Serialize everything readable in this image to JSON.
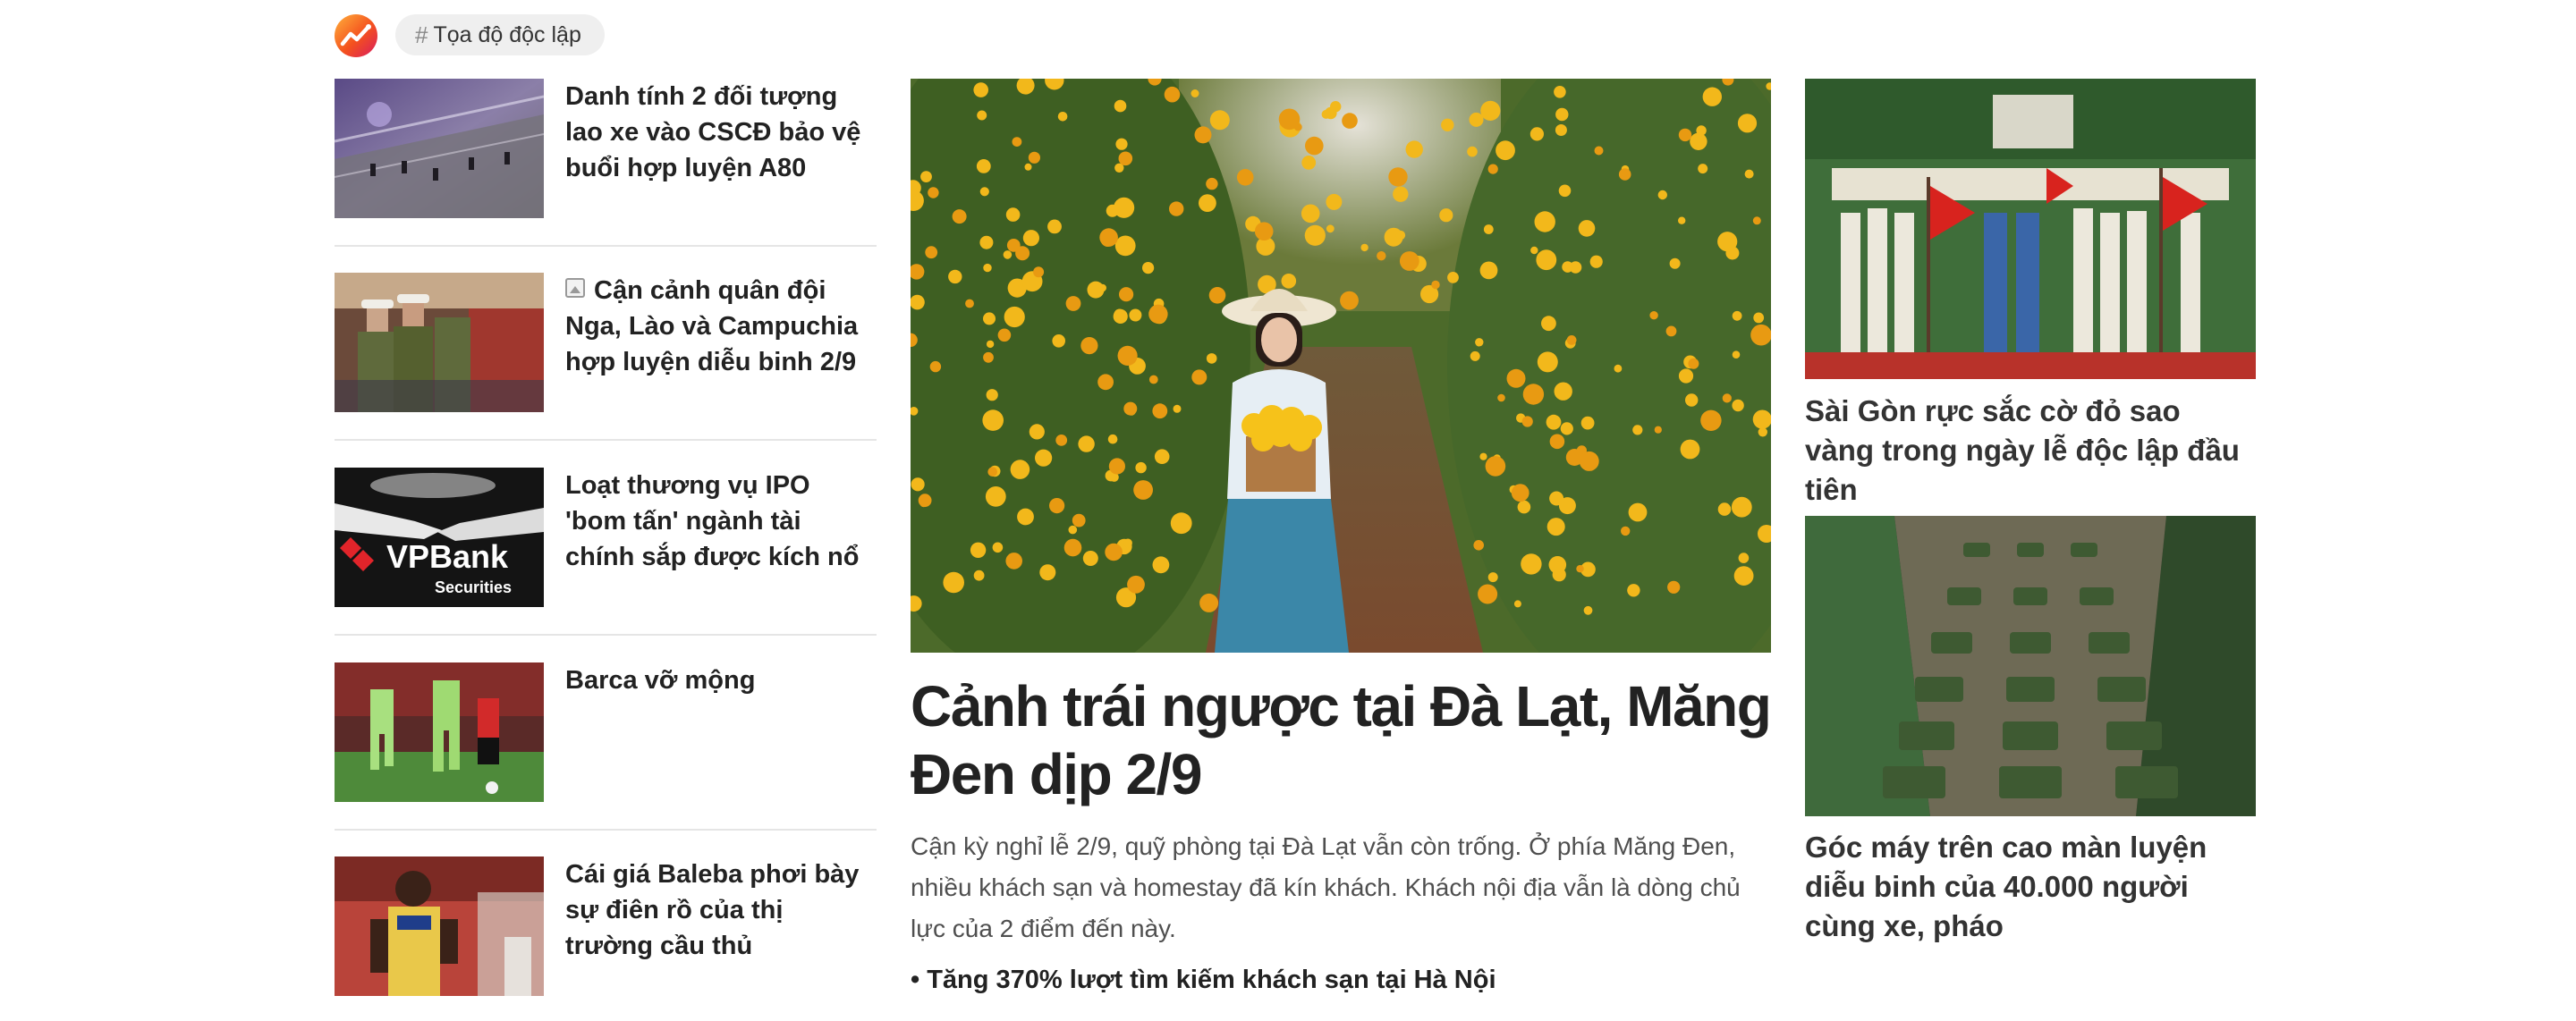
{
  "header": {
    "logo_icon": "trending-logo-icon",
    "tag_icon": "hash",
    "tag_label": "Tọa độ độc lập"
  },
  "left_list": [
    {
      "title": "Danh tính 2 đối tượng lao xe vào CSCĐ bảo vệ buổi hợp luyện A80",
      "has_gallery_icon": false
    },
    {
      "title": "Cận cảnh quân đội Nga, Lào và Campuchia hợp luyện diễu binh 2/9",
      "has_gallery_icon": true
    },
    {
      "title": "Loạt thương vụ IPO 'bom tấn' ngành tài chính sắp được kích nổ",
      "has_gallery_icon": false,
      "image_text": [
        "VPBank",
        "Securities"
      ]
    },
    {
      "title": "Barca vỡ mộng",
      "has_gallery_icon": false
    },
    {
      "title": "Cái giá Baleba phơi bày sự điên rồ của thị trường cầu thủ",
      "has_gallery_icon": false
    }
  ],
  "main": {
    "title": "Cảnh trái ngược tại Đà Lạt, Măng Đen dịp 2/9",
    "lead": "Cận kỳ nghỉ lễ 2/9, quỹ phòng tại Đà Lạt vẫn còn trống. Ở phía Măng Đen, nhiều khách sạn và homestay đã kín khách. Khách nội địa vẫn là dòng chủ lực của 2 điểm đến này.",
    "related_bullet": "•",
    "related": "Tăng 370% lượt tìm kiếm khách sạn tại Hà Nội"
  },
  "right": [
    {
      "title": "Sài Gòn rực sắc cờ đỏ sao vàng trong ngày lễ độc lập đầu tiên"
    },
    {
      "title": "Góc máy trên cao màn luyện diễu binh của 40.000 người cùng xe, pháo"
    }
  ],
  "colors": {
    "accent": "#f4511e",
    "text": "#222222",
    "lead": "#4f4f4f",
    "separator": "#e5e5e5",
    "pill": "#efefef"
  }
}
